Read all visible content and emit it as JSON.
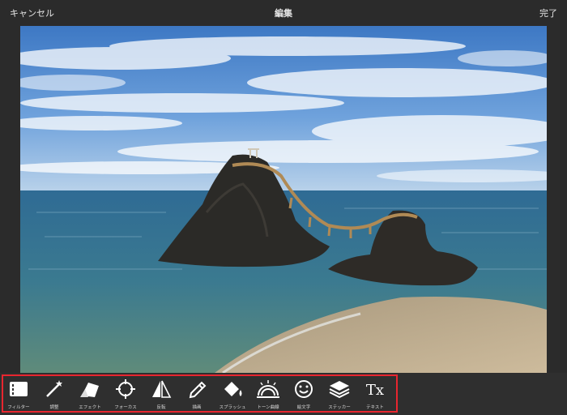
{
  "header": {
    "cancel_label": "キャンセル",
    "title": "編集",
    "done_label": "完了"
  },
  "toolbar": {
    "tools": [
      {
        "label": "フィルター",
        "icon": "filter-icon"
      },
      {
        "label": "調整",
        "icon": "adjust-wand-icon"
      },
      {
        "label": "エフェクト",
        "icon": "effect-icon"
      },
      {
        "label": "フォーカス",
        "icon": "focus-crosshair-icon"
      },
      {
        "label": "反転",
        "icon": "flip-icon"
      },
      {
        "label": "描画",
        "icon": "pencil-icon"
      },
      {
        "label": "スプラッシュ",
        "icon": "splash-bucket-icon"
      },
      {
        "label": "トーン曲線",
        "icon": "tone-curve-icon"
      },
      {
        "label": "絵文字",
        "icon": "emoji-smiley-icon"
      },
      {
        "label": "ステッカー",
        "icon": "sticker-layers-icon"
      },
      {
        "label": "テキスト",
        "icon": "text-tx-icon",
        "glyph": "Tx"
      }
    ],
    "highlight_color": "#e8262f"
  }
}
